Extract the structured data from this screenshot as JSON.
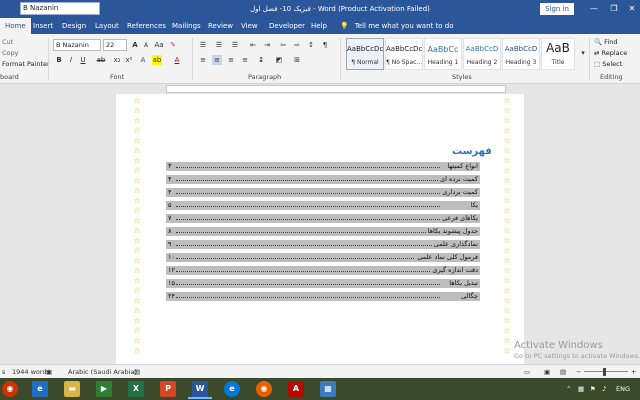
{
  "titlebar": {
    "font_value": "B Nazanin",
    "title": "فیزیک 10- فصل اول  -  Word (Product Activation Failed)",
    "signin": "Sign in",
    "minimize": "—",
    "restore": "❐",
    "close": "✕"
  },
  "tabs": [
    "Home",
    "Insert",
    "Design",
    "Layout",
    "References",
    "Mailings",
    "Review",
    "View",
    "Developer",
    "Help"
  ],
  "tellme": "Tell me what you want to do",
  "ribbon": {
    "clipboard": {
      "cut": "Cut",
      "copy": "Copy",
      "format_painter": "Format Painter",
      "label": "board"
    },
    "font": {
      "name": "B Nazanin",
      "size": "22",
      "label": "Font",
      "bold": "B",
      "italic": "I",
      "underline": "U",
      "grow": "A",
      "shrink": "A",
      "case": "Aa",
      "font_color": "A"
    },
    "paragraph": {
      "label": "Paragraph",
      "pilcrow": "¶"
    },
    "styles": {
      "label": "Styles",
      "items": [
        {
          "sample": "AaBbCcDc",
          "name": "¶ Normal"
        },
        {
          "sample": "AaBbCcDc",
          "name": "¶ No Spac..."
        },
        {
          "sample": "AaBbCc",
          "name": "Heading 1"
        },
        {
          "sample": "AaBbCcD",
          "name": "Heading 2"
        },
        {
          "sample": "AaBbCcD",
          "name": "Heading 3"
        },
        {
          "sample": "AaB",
          "name": "Title"
        }
      ]
    },
    "editing": {
      "find": "Find",
      "replace": "Replace",
      "select": "Select",
      "label": "Editing"
    }
  },
  "document": {
    "toc_heading": "فهرست",
    "toc": [
      {
        "title": "انواع کمیتها",
        "page": "۳"
      },
      {
        "title": "کمیت نرده ای",
        "page": "۴"
      },
      {
        "title": "کمیت برداری",
        "page": "۴"
      },
      {
        "title": "یکا",
        "page": "۵"
      },
      {
        "title": "یکاهای فرعی",
        "page": "۷"
      },
      {
        "title": "جدول پیشوند یکاها",
        "page": "۸"
      },
      {
        "title": "نمادگذاری علمی",
        "page": "۹"
      },
      {
        "title": "فرمول کلی نماد علمی",
        "page": "۱۰"
      },
      {
        "title": "دقت اندازه گیری",
        "page": "۱۲"
      },
      {
        "title": "تبدیل یکاها",
        "page": "۱۵"
      },
      {
        "title": "چگالی",
        "page": "۲۴"
      }
    ],
    "star": "☆"
  },
  "watermark": {
    "title": "Activate Windows",
    "sub": "Go to PC settings to activate Windows."
  },
  "statusbar": {
    "page": "s",
    "words": "1944 words",
    "language": "Arabic (Saudi Arabia)",
    "zoom_minus": "−",
    "zoom_plus": "+"
  },
  "taskbar": {
    "lang": "ENG"
  }
}
